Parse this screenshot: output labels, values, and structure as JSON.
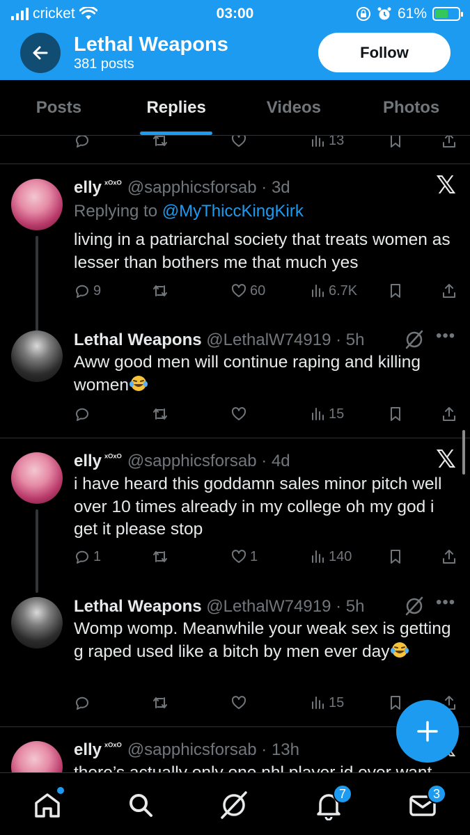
{
  "status_bar": {
    "carrier": "cricket",
    "time": "03:00",
    "battery": "61%",
    "battery_level": 0.61
  },
  "header": {
    "title": "Lethal Weapons",
    "subtitle": "381 posts",
    "follow_label": "Follow"
  },
  "tabs": [
    {
      "label": "Posts",
      "active": false
    },
    {
      "label": "Replies",
      "active": true
    },
    {
      "label": "Videos",
      "active": false
    },
    {
      "label": "Photos",
      "active": false
    }
  ],
  "top_actions": {
    "views": "13"
  },
  "posts": [
    {
      "name": "elly",
      "name_suffix": "ˣᴼˣᴼ",
      "handle": "@sapphicsforsab",
      "time": "· 3d",
      "replying_prefix": "Replying to",
      "replying_to": "@MyThiccKingKirk",
      "text": "living in a patriarchal society that treats women as lesser than bothers me that much yes",
      "replies": "9",
      "reposts": "",
      "likes": "60",
      "views": "6.7K"
    },
    {
      "name": "Lethal Weapons",
      "handle": "@LethalW74919",
      "time": "· 5h",
      "text": "Aww good men will continue raping and killing women",
      "replies": "",
      "reposts": "",
      "likes": "",
      "views": "15"
    },
    {
      "name": "elly",
      "name_suffix": "ˣᴼˣᴼ",
      "handle": "@sapphicsforsab",
      "time": "· 4d",
      "text": "i have heard this goddamn sales minor pitch well over 10 times already in my college oh my god i get it please stop",
      "replies": "1",
      "reposts": "",
      "likes": "1",
      "views": "140"
    },
    {
      "name": "Lethal Weapons",
      "handle": "@LethalW74919",
      "time": "· 5h",
      "text": "Womp womp. Meanwhile your weak sex is getting g raped used like a bitch by men ever day",
      "replies": "",
      "reposts": "",
      "likes": "",
      "views": "15"
    },
    {
      "name": "elly",
      "name_suffix": "ˣᴼˣᴼ",
      "handle": "@sapphicsforsab",
      "time": "· 13h",
      "text": "there’s actually only one nhl player id ever want"
    }
  ],
  "bottom_nav": {
    "notifications_badge": "7",
    "messages_badge": "3"
  },
  "colors": {
    "accent": "#1d9bf0",
    "background": "#000000",
    "text": "#e7e9ea",
    "muted": "#71767b"
  }
}
